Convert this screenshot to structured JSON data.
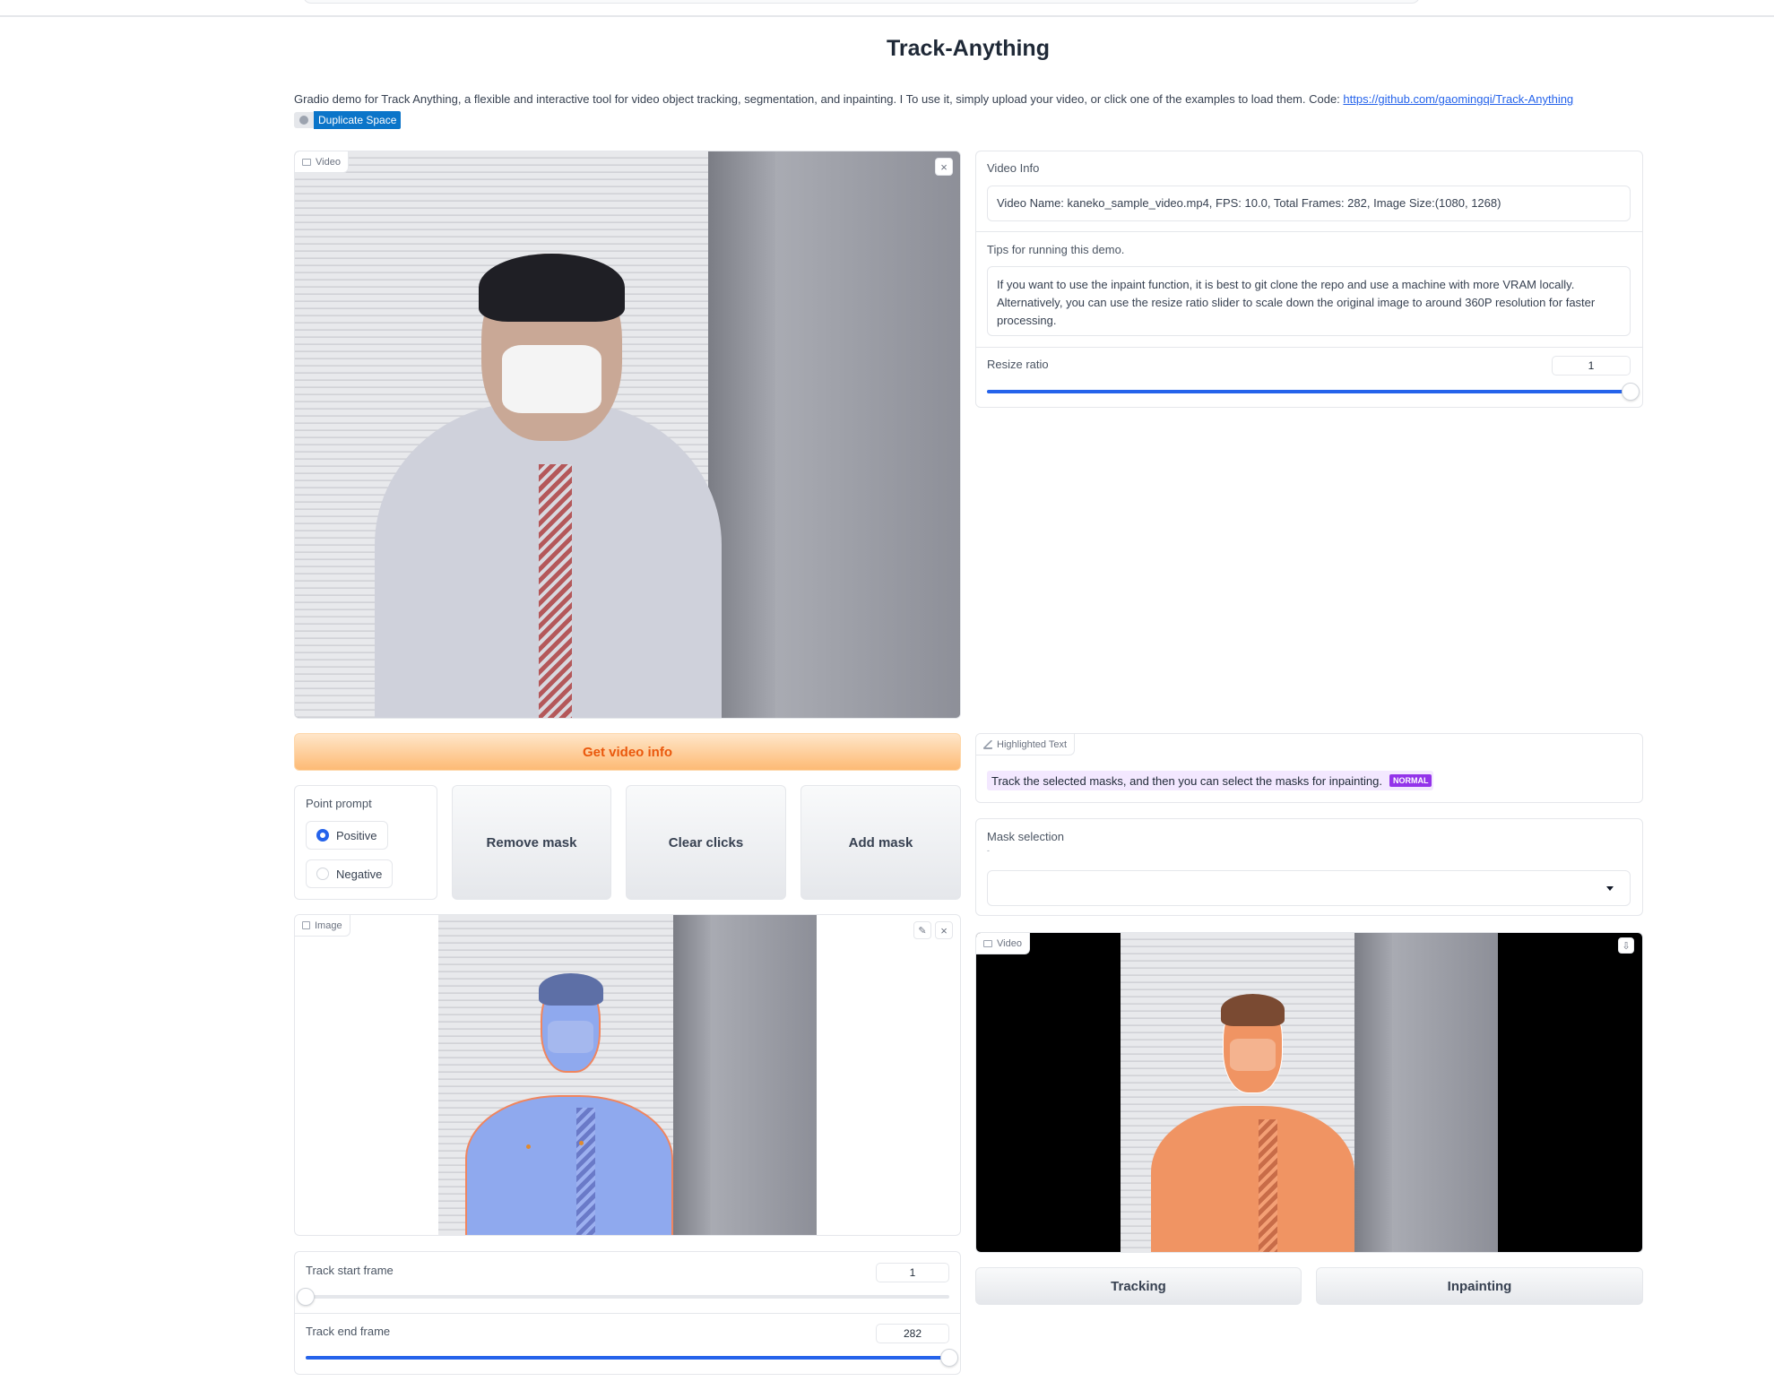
{
  "header": {
    "title": "Track-Anything",
    "description": "Gradio demo for Track Anything, a flexible and interactive tool for video object tracking, segmentation, and inpainting. I To use it, simply upload your video, or click one of the examples to load them. Code: ",
    "code_link": "https://github.com/gaomingqi/Track-Anything",
    "duplicate_label": "Duplicate Space"
  },
  "video_input": {
    "label": "Video",
    "close_symbol": "×"
  },
  "video_info": {
    "label": "Video Info",
    "value": "Video Name: kaneko_sample_video.mp4, FPS: 10.0, Total Frames: 282, Image Size:(1080, 1268)"
  },
  "tips": {
    "label": "Tips for running this demo.",
    "line1": "If you want to use the inpaint function, it is best to git clone the repo and use a machine with more VRAM locally.",
    "line2": "Alternatively, you can use the resize ratio slider to scale down the original image to around 360P resolution for faster",
    "line3": "processing."
  },
  "resize_ratio": {
    "label": "Resize ratio",
    "value": "1",
    "fraction": 1.0
  },
  "get_video_info_button": "Get video info",
  "highlighted_text": {
    "label": "Highlighted Text",
    "text": "Track the selected masks, and then you can select the masks for inpainting.",
    "badge": "NORMAL"
  },
  "point_prompt": {
    "label": "Point prompt",
    "options": [
      "Positive",
      "Negative"
    ],
    "selected": "Positive"
  },
  "buttons": {
    "remove_mask": "Remove mask",
    "clear_clicks": "Clear clicks",
    "add_mask": "Add mask",
    "tracking": "Tracking",
    "inpainting": "Inpainting"
  },
  "mask_selection": {
    "label": "Mask selection",
    "hint": "-",
    "value": ""
  },
  "image_panel": {
    "label": "Image"
  },
  "video_output": {
    "label": "Video"
  },
  "track_start": {
    "label": "Track start frame",
    "value": "1",
    "fraction": 0.0
  },
  "track_end": {
    "label": "Track end frame",
    "value": "282",
    "fraction": 1.0
  },
  "icons": {
    "close": "close-icon",
    "edit": "pencil-icon",
    "download": "download-icon",
    "video": "video-camera-icon",
    "image": "image-icon",
    "highlight": "highlighter-icon",
    "dropdown": "chevron-down-icon"
  },
  "colors": {
    "accent_blue": "#2563eb",
    "primary_orange": "#ea580c",
    "badge_purple": "#9333ea",
    "duplicate_blue": "#0b75c9",
    "segment_blue": "#8fa9ee",
    "segment_orange": "#f09463"
  }
}
